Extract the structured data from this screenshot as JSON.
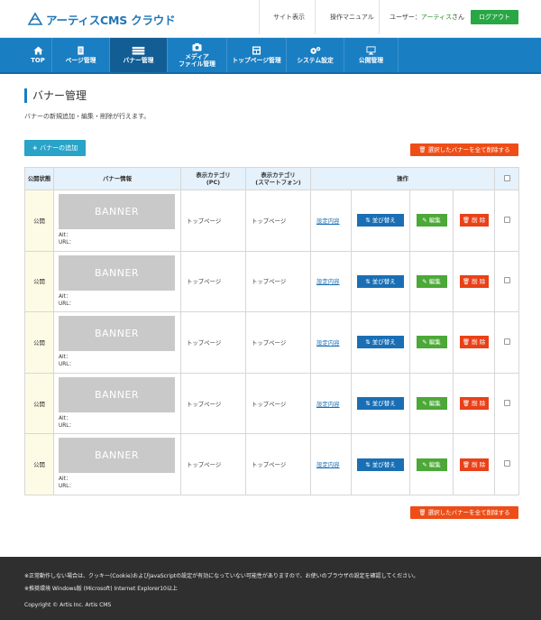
{
  "header": {
    "logo_text": "アーティスCMS クラウド",
    "site_view": "サイト表示",
    "manual": "操作マニュアル",
    "user_prefix": "ユーザー：",
    "user_name": "アーティス",
    "user_suffix": "さん",
    "logout": "ログアウト"
  },
  "nav": {
    "items": [
      {
        "label": "TOP",
        "icon": "home-icon"
      },
      {
        "label": "ページ管理",
        "icon": "page-icon"
      },
      {
        "label": "バナー管理",
        "icon": "banner-icon"
      },
      {
        "label": "メディア\nファイル管理",
        "icon": "camera-icon"
      },
      {
        "label": "トップページ管理",
        "icon": "toppage-icon"
      },
      {
        "label": "システム設定",
        "icon": "gears-icon"
      },
      {
        "label": "公開管理",
        "icon": "monitor-icon"
      }
    ],
    "active": 2
  },
  "main": {
    "title": "バナー管理",
    "description": "バナーの新規追加・編集・削除が行えます。",
    "add_button": "バナーの追加",
    "delete_all_button": "選択したバナーを全て削除する"
  },
  "table": {
    "headers": {
      "status": "公開状態",
      "info": "バナー情報",
      "category_pc": "表示カテゴリ\n(PC)",
      "category_sp": "表示カテゴリ\n(スマートフォン)",
      "operations": "操作"
    },
    "rows": [
      {
        "status": "公開",
        "banner": "BANNER",
        "alt": "Alt：",
        "url": "URL：",
        "cat_pc": "トップページ",
        "cat_sp": "トップページ",
        "settings": "設定内容",
        "sort": "並び替え",
        "edit": "編集",
        "delete": "削 除"
      },
      {
        "status": "公開",
        "banner": "BANNER",
        "alt": "Alt：",
        "url": "URL：",
        "cat_pc": "トップページ",
        "cat_sp": "トップページ",
        "settings": "設定内容",
        "sort": "並び替え",
        "edit": "編集",
        "delete": "削 除"
      },
      {
        "status": "公開",
        "banner": "BANNER",
        "alt": "Alt：",
        "url": "URL：",
        "cat_pc": "トップページ",
        "cat_sp": "トップページ",
        "settings": "設定内容",
        "sort": "並び替え",
        "edit": "編集",
        "delete": "削 除"
      },
      {
        "status": "公開",
        "banner": "BANNER",
        "alt": "Alt：",
        "url": "URL：",
        "cat_pc": "トップページ",
        "cat_sp": "トップページ",
        "settings": "設定内容",
        "sort": "並び替え",
        "edit": "編集",
        "delete": "削 除"
      },
      {
        "status": "公開",
        "banner": "BANNER",
        "alt": "Alt：",
        "url": "URL：",
        "cat_pc": "トップページ",
        "cat_sp": "トップページ",
        "settings": "設定内容",
        "sort": "並び替え",
        "edit": "編集",
        "delete": "削 除"
      }
    ]
  },
  "footer": {
    "notice": "※正常動作しない場合は、クッキー(Cookie)およびJavaScriptの設定が有効になっていない可能性がありますので、お使いのブラウザの設定を確認してください。",
    "env": "※推奨環境 Windows版 (Microsoft) Internet Explorer10以上",
    "copyright": "Copyright © Artis Inc. Artis CMS"
  },
  "colors": {
    "nav_bg": "#1a7ec2",
    "nav_active": "#115d94",
    "logout": "#28a745",
    "add": "#29a3c8",
    "delete_all": "#ee4d17",
    "sort": "#1a6fb4",
    "edit": "#4ca837",
    "delete": "#e94118",
    "footer": "#2f2f2f"
  }
}
